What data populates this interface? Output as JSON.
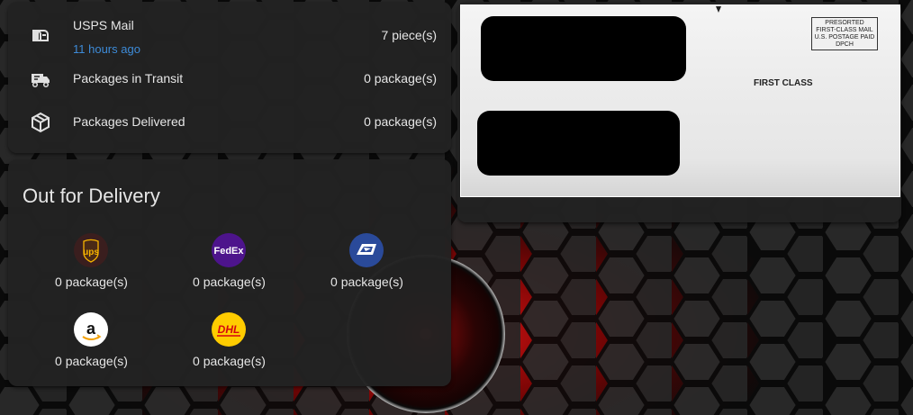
{
  "mail": {
    "usps": {
      "label": "USPS Mail",
      "updated": "11 hours ago",
      "value": "7 piece(s)",
      "icon": "mailbox-icon"
    },
    "in_transit": {
      "label": "Packages in Transit",
      "value": "0 package(s)",
      "icon": "truck-icon"
    },
    "delivered": {
      "label": "Packages Delivered",
      "value": "0 package(s)",
      "icon": "package-icon"
    }
  },
  "delivery": {
    "title": "Out for Delivery",
    "carriers": [
      {
        "name": "UPS",
        "logo_text": "ups",
        "count": "0 package(s)"
      },
      {
        "name": "FedEx",
        "logo_text": "FedEx",
        "count": "0 package(s)"
      },
      {
        "name": "USPS",
        "count": "0 package(s)"
      },
      {
        "name": "Amazon",
        "logo_text": "a",
        "count": "0 package(s)"
      },
      {
        "name": "DHL",
        "logo_text": "DHL",
        "count": "0 package(s)"
      }
    ]
  },
  "envelope": {
    "permit_lines": [
      "PRESORTED",
      "FIRST-CLASS MAIL",
      "U.S. POSTAGE PAID",
      "DPCH"
    ],
    "class_label": "FIRST CLASS"
  },
  "colors": {
    "link": "#3d8bd8",
    "card": "#222222",
    "accent_red": "#e01010"
  }
}
